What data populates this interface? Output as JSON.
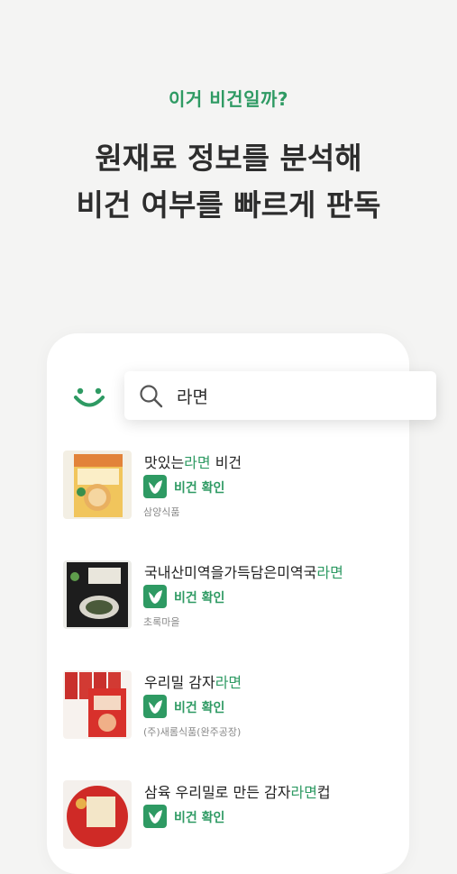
{
  "tagline": "이거 비건일까?",
  "headline": {
    "line1": "원재료 정보를 분석해",
    "line2": "비건 여부를 빠르게 판독"
  },
  "search": {
    "value": "라면"
  },
  "results": [
    {
      "pre": "맛있는",
      "hl": "라면",
      "post": " 비건",
      "status": "비건 확인",
      "maker": "삼양식품"
    },
    {
      "pre": "국내산미역을가득담은미역국",
      "hl": "라면",
      "post": "",
      "status": "비건 확인",
      "maker": "초록마을"
    },
    {
      "pre": "우리밀 감자",
      "hl": "라면",
      "post": "",
      "status": "비건 확인",
      "maker": "(주)새롬식품(완주공장)"
    },
    {
      "pre": "삼육 우리밀로 만든 감자",
      "hl": "라면",
      "post": "컵",
      "status": "비건 확인",
      "maker": ""
    }
  ],
  "colors": {
    "accent": "#2e9a63",
    "background": "#f4f4f3"
  },
  "icons": {
    "logo": "smile-icon",
    "search": "search-icon",
    "badge": "vegan-leaf-icon"
  }
}
